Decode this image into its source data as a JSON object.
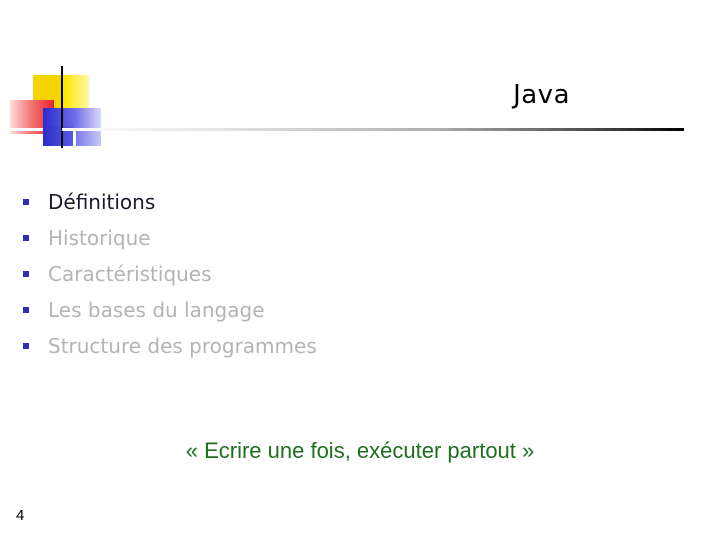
{
  "slide": {
    "title": "Java",
    "bullets": [
      {
        "label": "Définitions",
        "state": "active"
      },
      {
        "label": "Historique",
        "state": "dim"
      },
      {
        "label": "Caractéristiques",
        "state": "dim"
      },
      {
        "label": "Les bases du langage",
        "state": "dim"
      },
      {
        "label": "Structure des programmes",
        "state": "dim"
      }
    ],
    "quote": "« Ecrire une fois, exécuter partout »",
    "page_number": "4"
  },
  "colors": {
    "bullet": "#2e2eb8",
    "active_text": "#1a1a2e",
    "dim_text": "#b4b4b4",
    "quote_text": "#1f6f1f",
    "logo_yellow": "#f5d500",
    "logo_red": "#e8232a",
    "logo_blue": "#2a2ad0"
  }
}
